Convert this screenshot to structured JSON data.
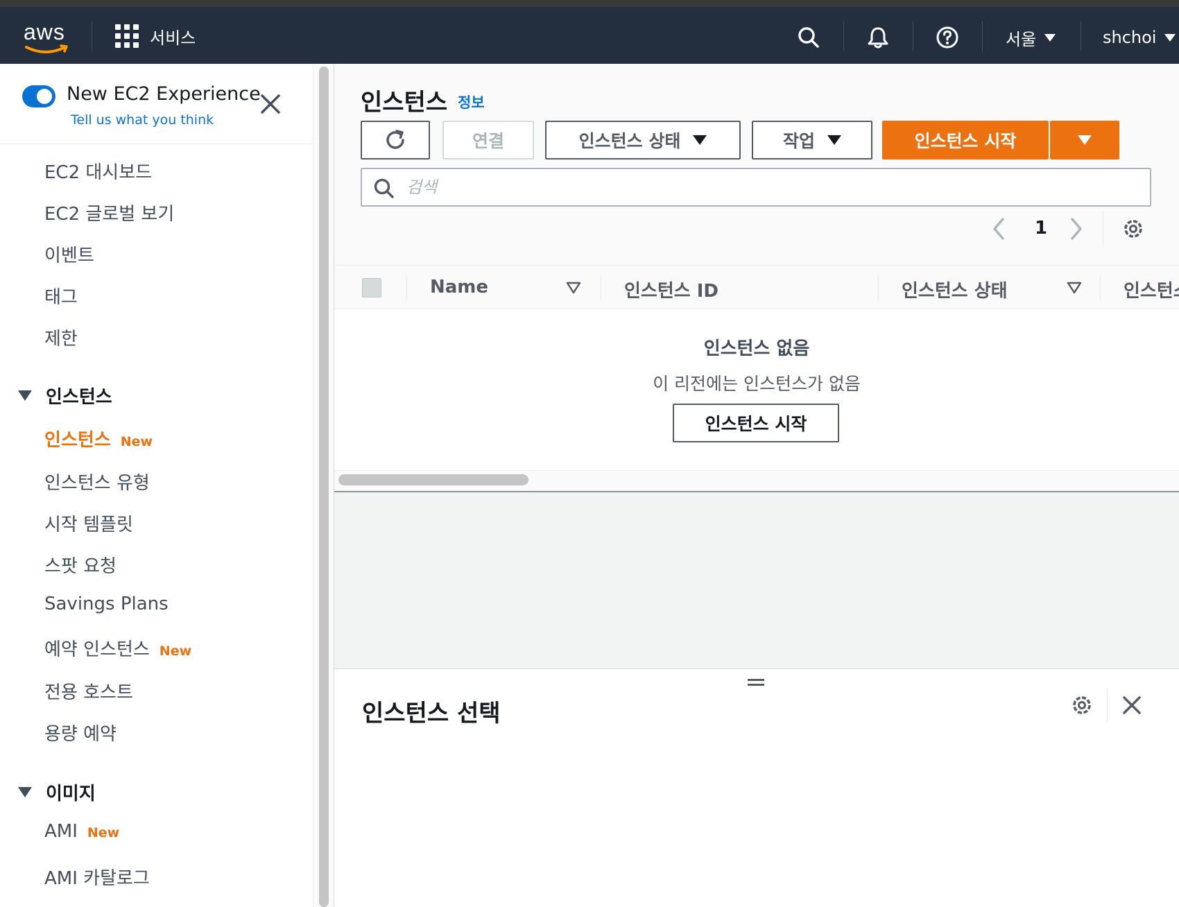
{
  "topnav": {
    "logo_text": "aws",
    "services_label": "서비스",
    "region_label": "서울",
    "user_label": "shchoi",
    "icons": [
      "search-icon",
      "bell-icon",
      "help-icon"
    ]
  },
  "sidebar": {
    "experience_title": "New EC2 Experience",
    "experience_link": "Tell us what you think",
    "toggle_on": true,
    "items_top": [
      {
        "label": "EC2 대시보드"
      },
      {
        "label": "EC2 글로벌 보기"
      },
      {
        "label": "이벤트"
      },
      {
        "label": "태그"
      },
      {
        "label": "제한"
      }
    ],
    "section_instances": {
      "label": "인스턴스",
      "items": [
        {
          "label": "인스턴스",
          "badge": "New",
          "active": true
        },
        {
          "label": "인스턴스 유형"
        },
        {
          "label": "시작 템플릿"
        },
        {
          "label": "스팟 요청"
        },
        {
          "label": "Savings Plans"
        },
        {
          "label": "예약 인스턴스",
          "badge": "New"
        },
        {
          "label": "전용 호스트"
        },
        {
          "label": "용량 예약"
        }
      ]
    },
    "section_images": {
      "label": "이미지",
      "items": [
        {
          "label": "AMI",
          "badge": "New"
        },
        {
          "label": "AMI 카탈로그"
        }
      ]
    }
  },
  "main": {
    "title": "인스턴스",
    "info_link": "정보",
    "buttons": {
      "connect": "연결",
      "instance_state": "인스턴스 상태",
      "actions": "작업",
      "launch": "인스턴스 시작"
    },
    "search_placeholder": "검색",
    "pagination": {
      "current_page": "1"
    },
    "columns": [
      "Name",
      "인스턴스 ID",
      "인스턴스 상태",
      "인스턴스 유형"
    ],
    "empty": {
      "title": "인스턴스 없음",
      "subtitle": "이 리전에는 인스턴스가 없음",
      "button": "인스턴스 시작"
    },
    "split_panel_title": "인스턴스 선택"
  },
  "colors": {
    "nav_bg": "#232f3e",
    "accent_orange": "#ec7211",
    "link_blue": "#0972d3"
  }
}
